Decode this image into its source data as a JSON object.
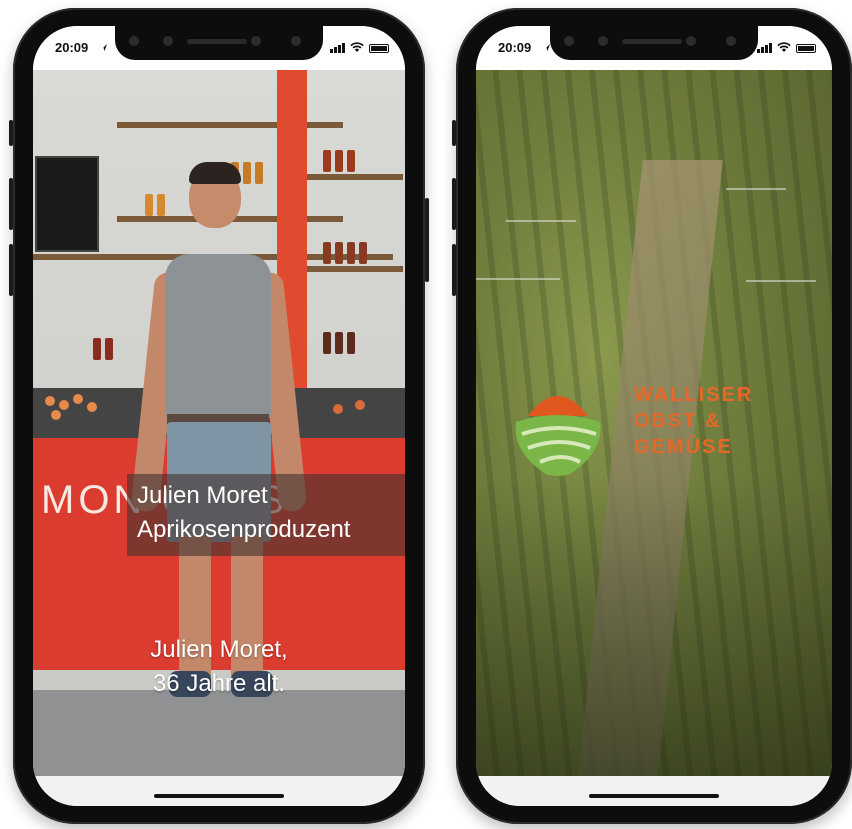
{
  "phones": [
    {
      "status": {
        "time": "20:09"
      },
      "video": {
        "stand_sign": "MON C  INS",
        "caption_name": "Julien Moret",
        "caption_role": "Aprikosenproduzent",
        "subtitle_line1": "Julien Moret,",
        "subtitle_line2": "36 Jahre alt."
      }
    },
    {
      "status": {
        "time": "20:09"
      },
      "video": {
        "brand_line1": "WALLISER",
        "brand_line2": "OBST &",
        "brand_line3": "GEMÜSE"
      }
    }
  ],
  "colors": {
    "stand_red": "#dc3b2f",
    "brand_orange": "#e5682a",
    "logo_green": "#7ab648",
    "logo_orange": "#e0571f"
  },
  "icons": [
    "location-arrow-icon",
    "signal-icon",
    "wifi-icon",
    "battery-icon"
  ]
}
